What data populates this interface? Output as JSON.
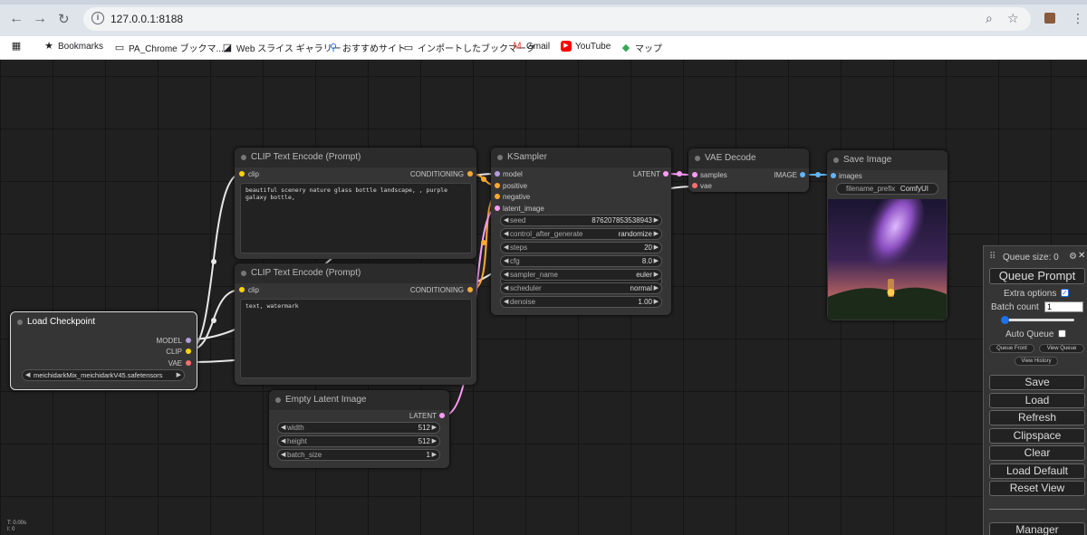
{
  "browser": {
    "url": "127.0.0.1:8188",
    "bookmarks": [
      "Bookmarks",
      "PA_Chrome ブックマ...",
      "Web スライス ギャラリー",
      "おすすめサイト",
      "インポートしたブックマーク",
      "Gmail",
      "YouTube",
      "マップ"
    ]
  },
  "nodes": {
    "clip1": {
      "title": "CLIP Text Encode (Prompt)",
      "input": "clip",
      "output": "CONDITIONING",
      "text": "beautiful scenery nature glass bottle landscape, , purple galaxy bottle,"
    },
    "clip2": {
      "title": "CLIP Text Encode (Prompt)",
      "input": "clip",
      "output": "CONDITIONING",
      "text": "text, watermark"
    },
    "ksampler": {
      "title": "KSampler",
      "inputs": [
        "model",
        "positive",
        "negative",
        "latent_image"
      ],
      "output": "LATENT",
      "widgets": [
        {
          "label": "seed",
          "value": "876207853538943"
        },
        {
          "label": "control_after_generate",
          "value": "randomize"
        },
        {
          "label": "steps",
          "value": "20"
        },
        {
          "label": "cfg",
          "value": "8.0"
        },
        {
          "label": "sampler_name",
          "value": "euler"
        },
        {
          "label": "scheduler",
          "value": "normal"
        },
        {
          "label": "denoise",
          "value": "1.00"
        }
      ]
    },
    "vae": {
      "title": "VAE Decode",
      "inputs": [
        "samples",
        "vae"
      ],
      "output": "IMAGE"
    },
    "save": {
      "title": "Save Image",
      "input": "images",
      "prefix_label": "filename_prefix",
      "prefix_value": "ComfyUI"
    },
    "checkpoint": {
      "title": "Load Checkpoint",
      "outputs": [
        "MODEL",
        "CLIP",
        "VAE"
      ],
      "ckpt": "meichidarkMix_meichidarkV45.safetensors"
    },
    "latent": {
      "title": "Empty Latent Image",
      "output": "LATENT",
      "widgets": [
        {
          "label": "width",
          "value": "512"
        },
        {
          "label": "height",
          "value": "512"
        },
        {
          "label": "batch_size",
          "value": "1"
        }
      ]
    }
  },
  "menu": {
    "queue_size": "Queue size: 0",
    "queue_prompt": "Queue Prompt",
    "extra_options": "Extra options",
    "batch_count_label": "Batch count",
    "batch_count_value": "1",
    "auto_queue": "Auto Queue",
    "queue_front": "Queue Front",
    "view_queue": "View Queue",
    "view_history": "View History",
    "buttons": [
      "Save",
      "Load",
      "Refresh",
      "Clipspace",
      "Clear",
      "Load Default",
      "Reset View"
    ],
    "manager": "Manager"
  },
  "stats": {
    "t": "T: 0.00s",
    "i": "I: 0"
  },
  "colors": {
    "clip": "#ffd500",
    "conditioning": "#ffa931",
    "model": "#b39ddb",
    "latent": "#ff9cf9",
    "vae": "#ff6e6e",
    "image": "#64b5f6"
  }
}
